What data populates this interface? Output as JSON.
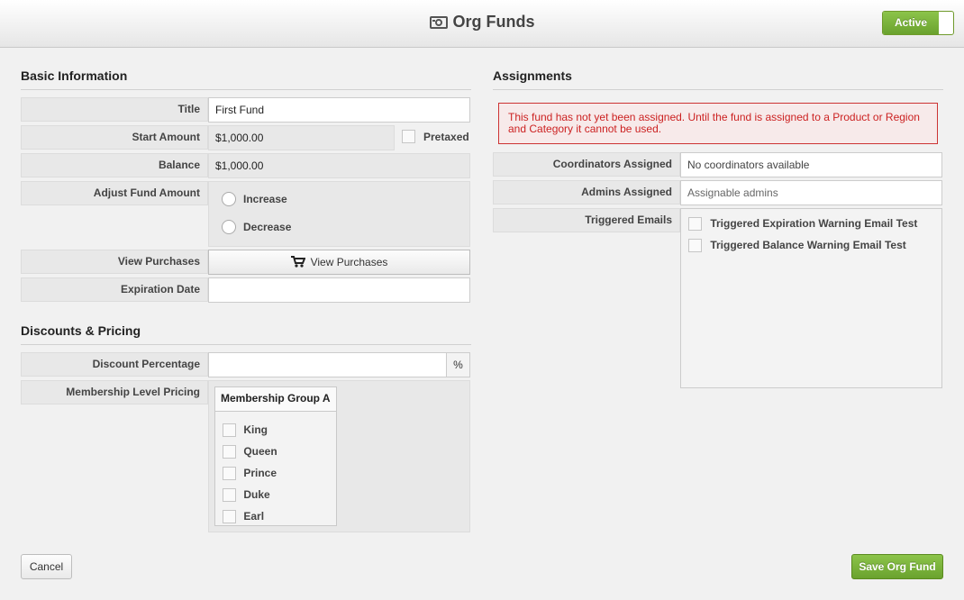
{
  "header": {
    "title": "Org Funds",
    "icon": "money-icon",
    "status_toggle": "Active"
  },
  "basic": {
    "heading": "Basic Information",
    "title_label": "Title",
    "title_value": "First Fund",
    "start_amount_label": "Start Amount",
    "start_amount_value": "$1,000.00",
    "pretaxed_label": "Pretaxed",
    "balance_label": "Balance",
    "balance_value": "$1,000.00",
    "adjust_label": "Adjust Fund Amount",
    "increase_label": "Increase",
    "decrease_label": "Decrease",
    "view_purchases_label": "View Purchases",
    "view_purchases_button": "View Purchases",
    "expiration_label": "Expiration Date",
    "expiration_value": ""
  },
  "discounts": {
    "heading": "Discounts & Pricing",
    "discount_label": "Discount Percentage",
    "discount_value": "",
    "discount_unit": "%",
    "membership_label": "Membership Level Pricing",
    "group_name": "Membership Group A",
    "levels": [
      "King",
      "Queen",
      "Prince",
      "Duke",
      "Earl"
    ]
  },
  "assignments": {
    "heading": "Assignments",
    "alert": "This fund has not yet been assigned. Until the fund is assigned to a Product or Region and Category it cannot be used.",
    "coordinators_label": "Coordinators Assigned",
    "coordinators_value": "No coordinators available",
    "admins_label": "Admins Assigned",
    "admins_placeholder": "Assignable admins",
    "emails_label": "Triggered Emails",
    "emails": [
      "Triggered Expiration Warning Email Test",
      "Triggered Balance Warning Email Test"
    ]
  },
  "footer": {
    "cancel": "Cancel",
    "save": "Save Org Fund"
  },
  "colors": {
    "accent_green": "#7ab33b",
    "alert_red": "#cc2222"
  }
}
